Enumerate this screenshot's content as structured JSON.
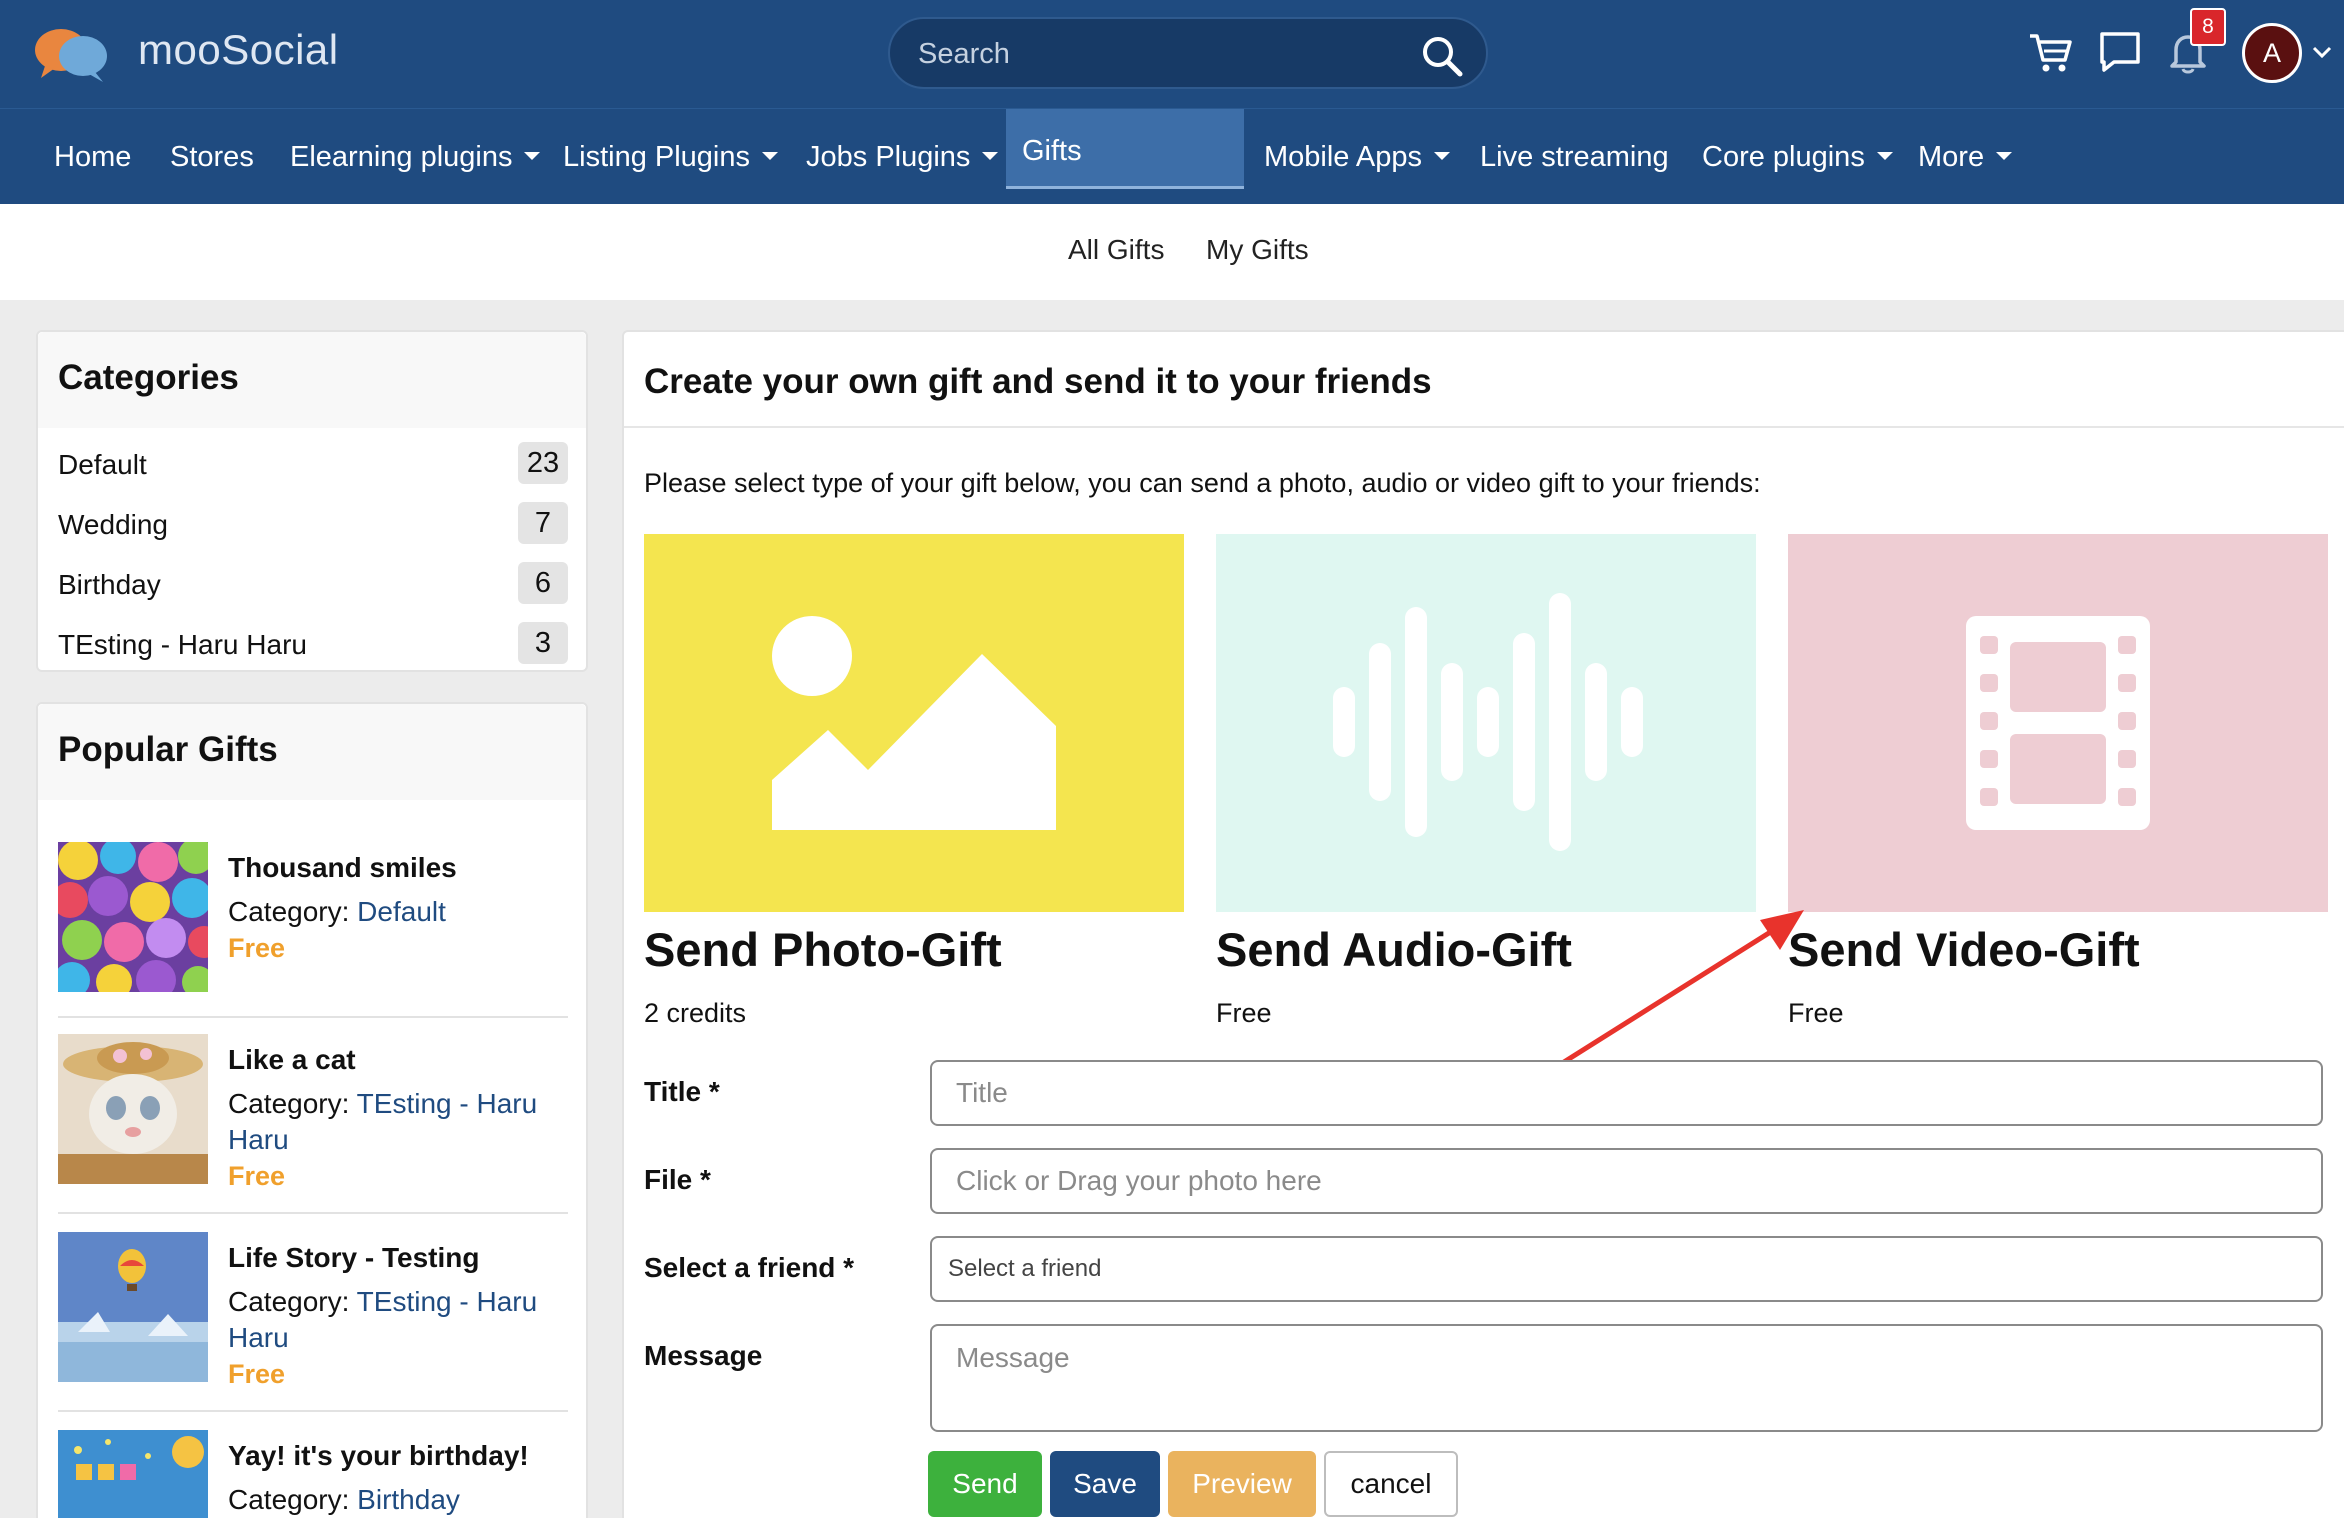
{
  "header": {
    "brand": "mooSocial",
    "search_placeholder": "Search",
    "notification_count": "8",
    "avatar_initial": "A"
  },
  "nav": {
    "items": [
      {
        "label": "Home"
      },
      {
        "label": "Stores"
      },
      {
        "label": "Elearning plugins"
      },
      {
        "label": "Listing Plugins"
      },
      {
        "label": "Jobs Plugins"
      },
      {
        "label": "Gifts"
      },
      {
        "label": "Mobile Apps"
      },
      {
        "label": "Live streaming"
      },
      {
        "label": "Core plugins"
      },
      {
        "label": "More"
      }
    ]
  },
  "subnav": {
    "all_gifts": "All Gifts",
    "my_gifts": "My Gifts"
  },
  "sidebar": {
    "categories_title": "Categories",
    "categories": [
      {
        "name": "Default",
        "count": "23"
      },
      {
        "name": "Wedding",
        "count": "7"
      },
      {
        "name": "Birthday",
        "count": "6"
      },
      {
        "name": "TEsting - Haru Haru",
        "count": "3"
      }
    ],
    "popular_title": "Popular Gifts",
    "category_prefix": "Category: ",
    "gifts": [
      {
        "name": "Thousand smiles",
        "category": "Default",
        "price": "Free"
      },
      {
        "name": "Like a cat",
        "category": "TEsting - Haru Haru",
        "price": "Free"
      },
      {
        "name": "Life Story - Testing",
        "category": "TEsting - Haru Haru",
        "price": "Free"
      },
      {
        "name": "Yay! it's your birthday!",
        "category": "Birthday",
        "price": ""
      }
    ]
  },
  "main": {
    "title": "Create your own gift and send it to your friends",
    "intro": "Please select type of your gift below, you can send a photo, audio or video gift to your friends:",
    "tiles": [
      {
        "title": "Send Photo-Gift",
        "price": "2 credits",
        "color": "#f4e54f"
      },
      {
        "title": "Send Audio-Gift",
        "price": "Free",
        "color": "#dff7f1"
      },
      {
        "title": "Send Video-Gift",
        "price": "Free",
        "color": "#eecdd3"
      }
    ],
    "form": {
      "title_label": "Title *",
      "title_placeholder": "Title",
      "file_label": "File *",
      "file_placeholder": "Click or Drag your photo here",
      "friend_label": "Select a friend *",
      "friend_placeholder": "Select a friend",
      "message_label": "Message",
      "message_placeholder": "Message"
    },
    "buttons": {
      "send": "Send",
      "save": "Save",
      "preview": "Preview",
      "cancel": "cancel"
    }
  },
  "colors": {
    "header_bg": "#1f4b80",
    "active_tab": "#3d6ea8",
    "link": "#1f4b80",
    "price_free": "#f0a02c",
    "send_btn": "#3db13d",
    "save_btn": "#1f4b80",
    "preview_btn": "#eab35e",
    "annotation_arrow": "#e8332c"
  }
}
